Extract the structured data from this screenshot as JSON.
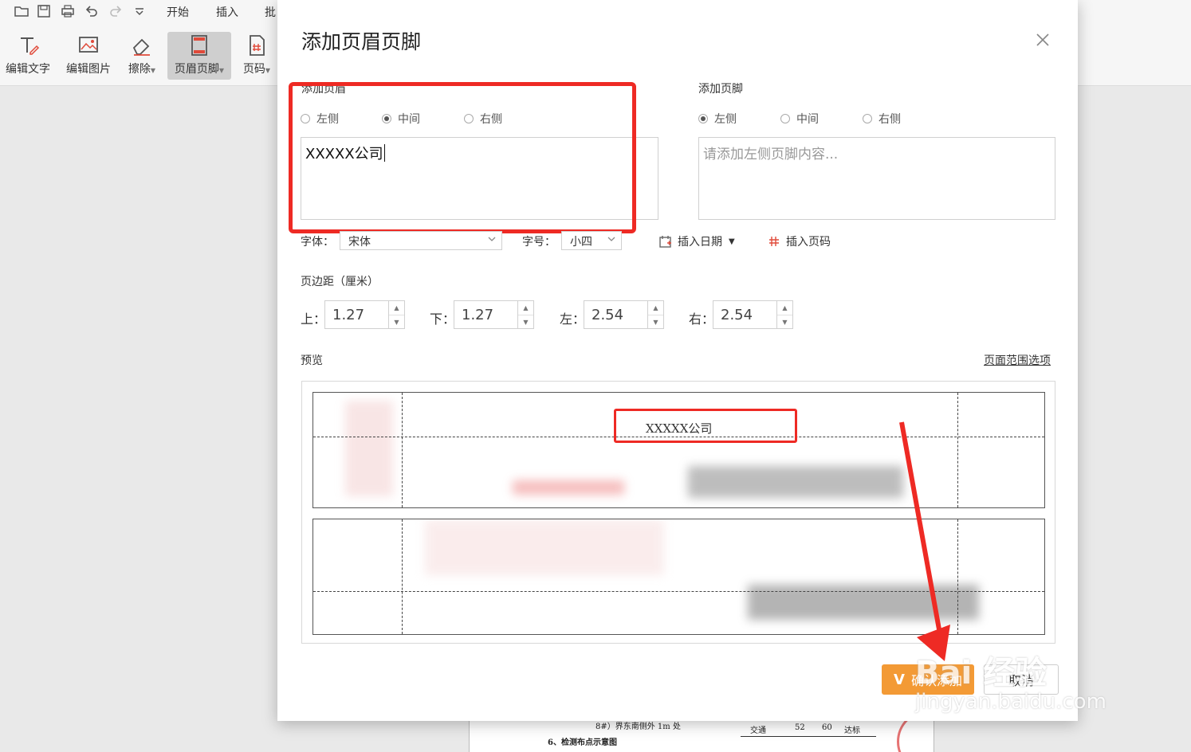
{
  "menu_tabs": [
    "开始",
    "插入",
    "批"
  ],
  "toolbar": {
    "tools": [
      {
        "label": "编辑文字",
        "icon": "edit-text-icon"
      },
      {
        "label": "编辑图片",
        "icon": "edit-image-icon"
      },
      {
        "label": "擦除",
        "icon": "eraser-icon"
      },
      {
        "label": "页眉页脚",
        "icon": "header-footer-icon",
        "active": true
      },
      {
        "label": "页码",
        "icon": "page-number-icon"
      }
    ]
  },
  "dialog": {
    "title": "添加页眉页脚",
    "header": {
      "label": "添加页眉",
      "options": [
        "左侧",
        "中间",
        "右侧"
      ],
      "selected": "中间",
      "content": "XXXXX公司"
    },
    "footer": {
      "label": "添加页脚",
      "options": [
        "左侧",
        "中间",
        "右侧"
      ],
      "selected": "左侧",
      "placeholder": "请添加左侧页脚内容..."
    },
    "font_label": "字体：",
    "font_value": "宋体",
    "size_label": "字号：",
    "size_value": "小四",
    "insert_date": "插入日期",
    "insert_page_number": "插入页码",
    "margins_label": "页边距（厘米）",
    "margins": [
      {
        "label": "上：",
        "value": "1.27"
      },
      {
        "label": "下：",
        "value": "1.27"
      },
      {
        "label": "左：",
        "value": "2.54"
      },
      {
        "label": "右：",
        "value": "2.54"
      }
    ],
    "preview_label": "预览",
    "page_range_link": "页面范围选项",
    "preview_header_text": "XXXXX公司",
    "confirm_button": "确认添加",
    "cancel_button": "取消"
  },
  "document": {
    "lines": [
      "8#）界东南侧外 1m 处",
      "6、检测布点示意图"
    ],
    "table_cells": [
      "交通",
      "52",
      "60",
      "达标"
    ]
  },
  "watermark": {
    "main": "Bai 经验",
    "sub": "jingyan.baidu.com"
  },
  "colors": {
    "highlight_red": "#ee2a24",
    "confirm_orange": "#f39a35"
  }
}
